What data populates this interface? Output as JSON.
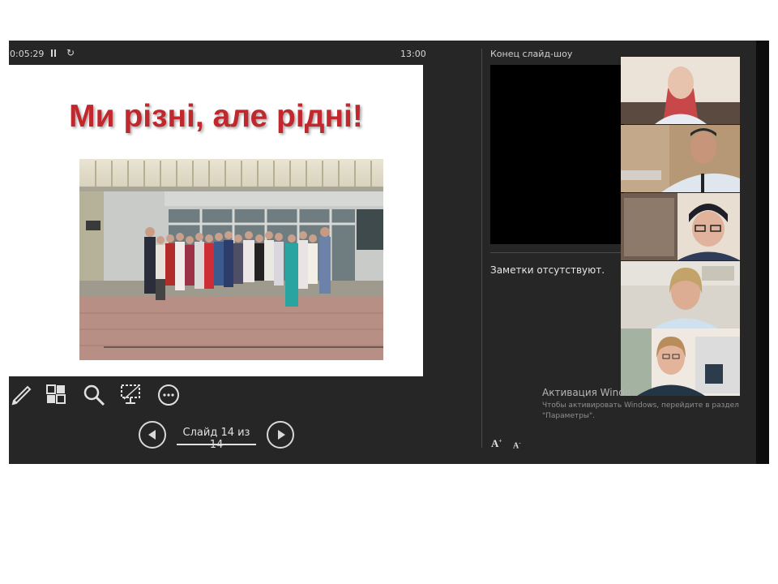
{
  "presenter": {
    "elapsed_time": "0:05:29",
    "clock_time": "13:00"
  },
  "slide": {
    "title": "Ми різні, але рідні!",
    "photo_icon": "group-photo"
  },
  "toolbar": {
    "icons": [
      "pen-icon",
      "slides-grid-icon",
      "zoom-icon",
      "screen-icon",
      "more-icon"
    ]
  },
  "navigation": {
    "counter": "Слайд 14 из 14"
  },
  "next_slide": {
    "label": "Конец слайд-шоу"
  },
  "notes": {
    "text": "Заметки отсутствуют."
  },
  "activation": {
    "title": "Активация Windo",
    "subtitle": "Чтобы активировать Windows, перейдите в раздел \"Параметры\"."
  },
  "font_controls": {
    "increase": "A",
    "decrease": "A"
  },
  "participants": [
    "participant-1",
    "participant-2",
    "participant-3",
    "participant-4",
    "participant-5"
  ],
  "colors": {
    "background": "#262626",
    "title_red": "#c0282e",
    "text_light": "#d8d8d8"
  }
}
